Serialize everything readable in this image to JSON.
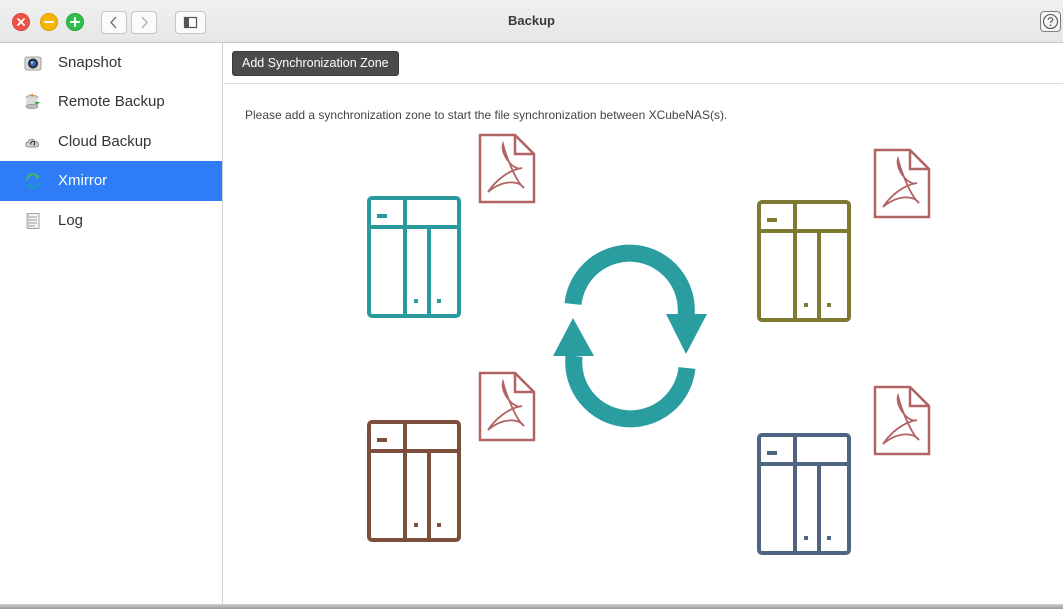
{
  "window": {
    "title": "Backup"
  },
  "titlebar": {
    "buttons": [
      "close-icon",
      "minimize-icon",
      "maximize-icon"
    ],
    "nav": [
      "back-arrow-icon",
      "forward-arrow-icon",
      "sidebar-toggle-icon"
    ],
    "help_icon": "question-mark-icon"
  },
  "sidebar": {
    "items": [
      {
        "label": "Snapshot",
        "icon": "camera-icon",
        "active": false
      },
      {
        "label": "Remote Backup",
        "icon": "database-sync-icon",
        "active": false
      },
      {
        "label": "Cloud Backup",
        "icon": "cloud-icon",
        "active": false
      },
      {
        "label": "Xmirror",
        "icon": "sync-arrows-icon",
        "active": true
      },
      {
        "label": "Log",
        "icon": "document-list-icon",
        "active": false
      }
    ]
  },
  "toolbar": {
    "add_zone_label": "Add Synchronization Zone"
  },
  "main": {
    "message": "Please add a synchronization zone to start the file synchronization between XCubeNAS(s).",
    "illustration": {
      "nas_colors": [
        "#2a9a9e",
        "#7e7a31",
        "#7b4f3b",
        "#4d6580"
      ],
      "pdf_color": "#b26363",
      "sync_color": "#2a9da1"
    }
  },
  "colors": {
    "accent": "#2e7df7",
    "button_dark": "#4b4b4b"
  }
}
